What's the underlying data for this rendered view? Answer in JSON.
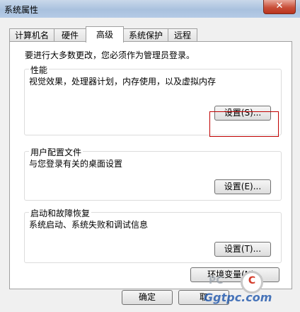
{
  "window": {
    "title": "系统属性",
    "close_glyph": "✕"
  },
  "tabs": [
    {
      "label": "计算机名",
      "active": false
    },
    {
      "label": "硬件",
      "active": false
    },
    {
      "label": "高级",
      "active": true
    },
    {
      "label": "系统保护",
      "active": false
    },
    {
      "label": "远程",
      "active": false
    }
  ],
  "panel": {
    "note": "要进行大多数更改，您必须作为管理员登录。",
    "performance": {
      "title": "性能",
      "description": "视觉效果，处理器计划，内存使用，以及虚拟内存",
      "button": "设置(S)..."
    },
    "user_profiles": {
      "title": "用户配置文件",
      "description": "与您登录有关的桌面设置",
      "button": "设置(E)..."
    },
    "startup_recovery": {
      "title": "启动和故障恢复",
      "description": "系统启动、系统失败和调试信息",
      "button": "设置(T)..."
    },
    "env_button": "环境变量(N)..."
  },
  "footer": {
    "ok": "确定",
    "cancel": "取"
  },
  "watermark": {
    "pc_text": "PC",
    "circle_text": "C",
    "site": "Ggtpc.com"
  },
  "colors": {
    "highlight_box": "#c00000",
    "title_bar": "#a9c1de",
    "close_button": "#c9503a"
  }
}
